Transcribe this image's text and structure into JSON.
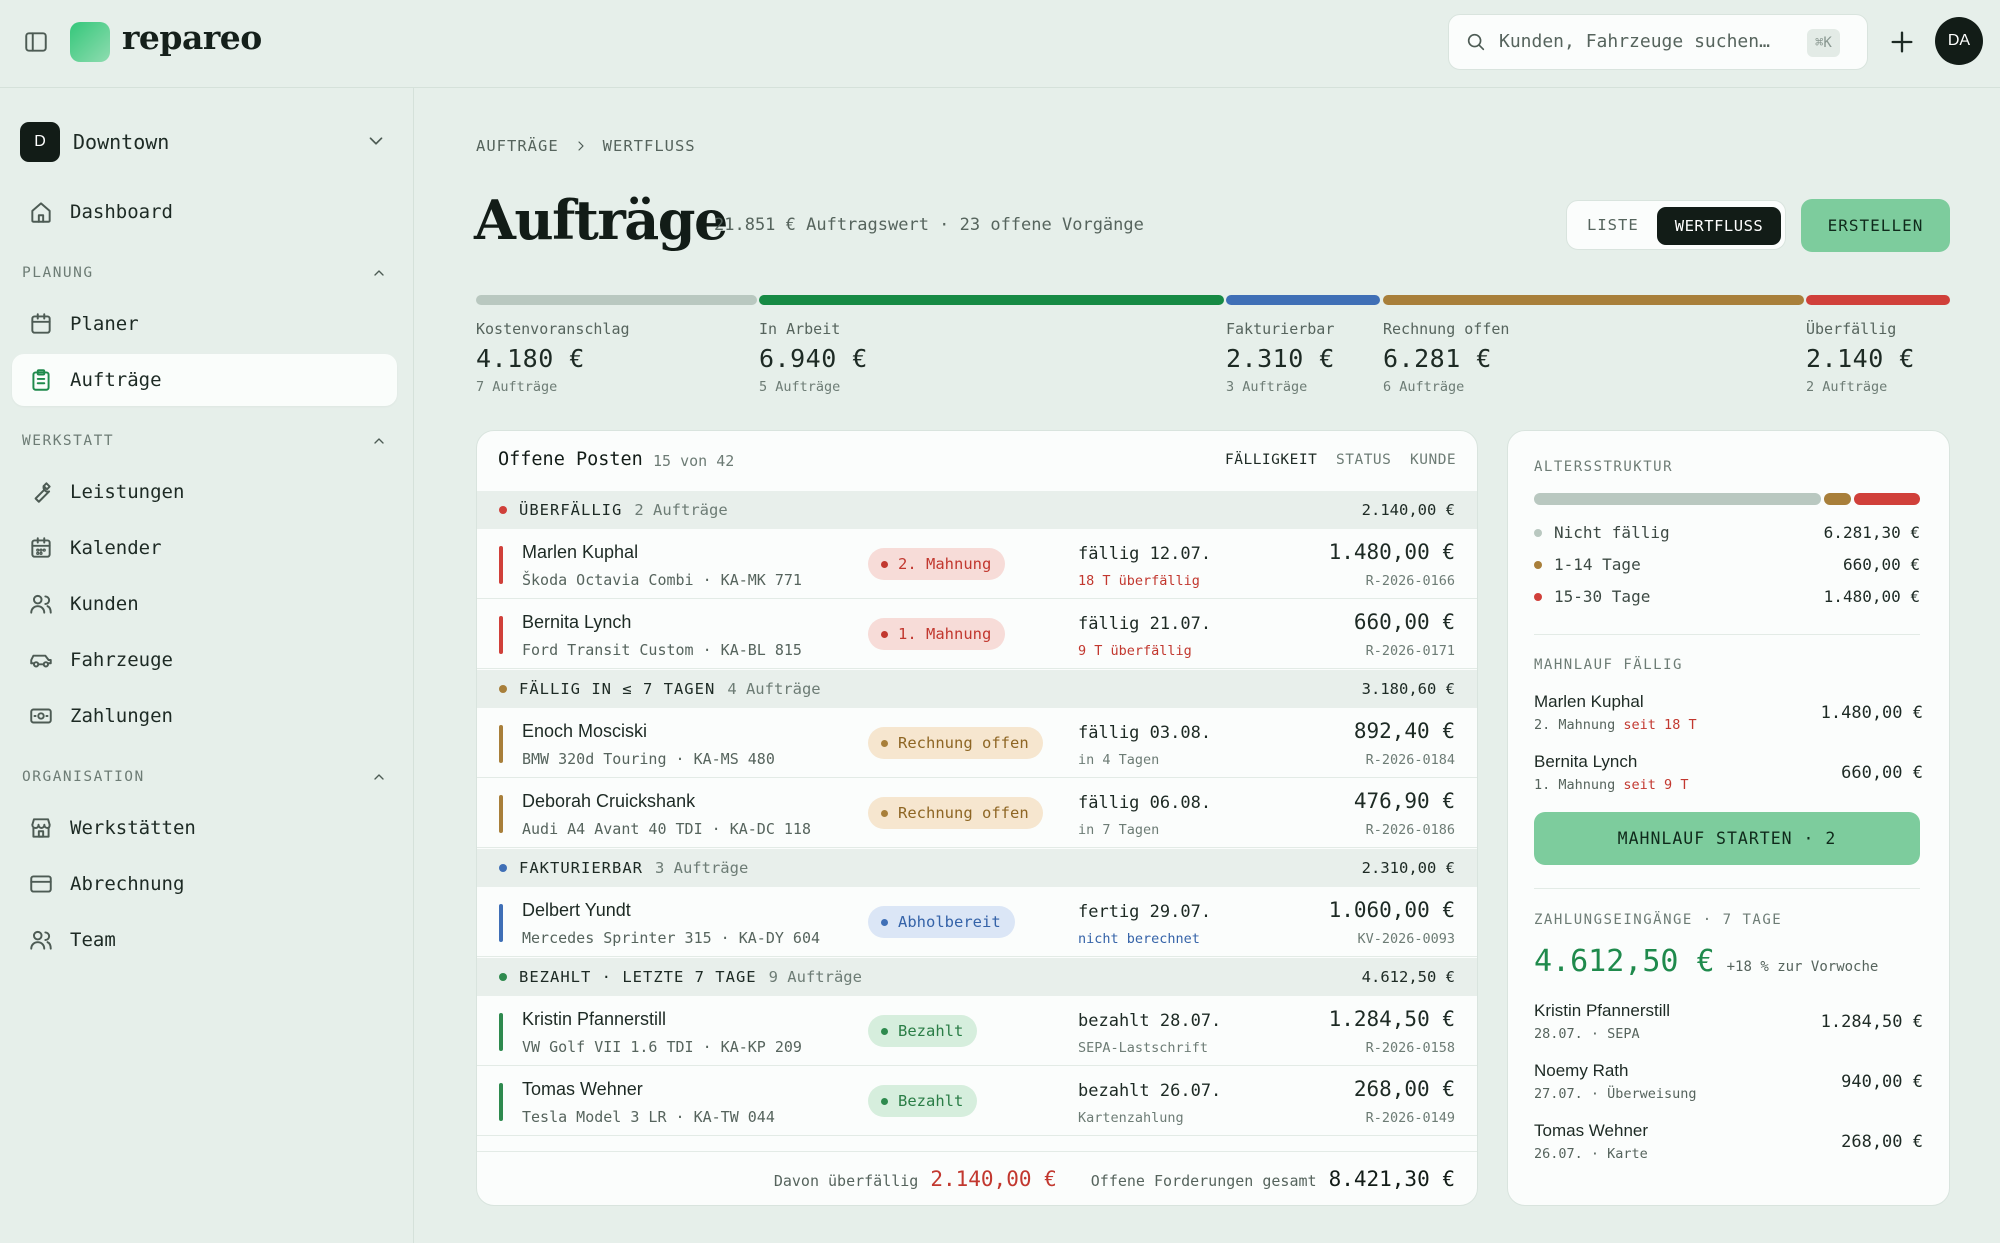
{
  "app": {
    "brand": "repareo",
    "search_placeholder": "Kunden, Fahrzeuge suchen…",
    "search_shortcut": "⌘K",
    "avatar": "DA"
  },
  "sidebar": {
    "location_initial": "D",
    "location_name": "Downtown",
    "dashboard": "Dashboard",
    "sections": [
      {
        "title": "PLANUNG",
        "items": [
          "Planer",
          "Aufträge"
        ]
      },
      {
        "title": "WERKSTATT",
        "items": [
          "Leistungen",
          "Kalender",
          "Kunden",
          "Fahrzeuge",
          "Zahlungen"
        ]
      },
      {
        "title": "ORGANISATION",
        "items": [
          "Werkstätten",
          "Abrechnung",
          "Team"
        ]
      }
    ]
  },
  "breadcrumb": {
    "root": "AUFTRÄGE",
    "current": "WERTFLUSS"
  },
  "header": {
    "title": "Aufträge",
    "subtitle": "21.851 € Auftragswert · 23 offene Vorgänge",
    "view_list": "LISTE",
    "view_flow": "WERTFLUSS",
    "create": "ERSTELLEN"
  },
  "pipeline": [
    {
      "label": "Kostenvoranschlag",
      "amount": "4.180 €",
      "count": "7 Aufträge",
      "color": "#b9c8c0"
    },
    {
      "label": "In Arbeit",
      "amount": "6.940 €",
      "count": "5 Aufträge",
      "color": "#168a44"
    },
    {
      "label": "Fakturierbar",
      "amount": "2.310 €",
      "count": "3 Aufträge",
      "color": "#3f6fb6"
    },
    {
      "label": "Rechnung offen",
      "amount": "6.281 €",
      "count": "6 Aufträge",
      "color": "#a87f3a"
    },
    {
      "label": "Überfällig",
      "amount": "2.140 €",
      "count": "2 Aufträge",
      "color": "#d0403a"
    }
  ],
  "open_items": {
    "title": "Offene Posten",
    "count": "15 von 42",
    "sort": [
      "FÄLLIGKEIT",
      "STATUS",
      "KUNDE"
    ],
    "groups": [
      {
        "label": "ÜBERFÄLLIG",
        "count": "2 Aufträge",
        "sum": "2.140,00 €",
        "color": "#d0403a",
        "rows": [
          {
            "name": "Marlen Kuphal",
            "vehicle": "Škoda Octavia Combi · KA-MK 771",
            "status": "2. Mahnung",
            "due": "fällig 12.07.",
            "due_sub": "18 T überfällig",
            "amount": "1.480,00 €",
            "invoice": "R-2026-0166"
          },
          {
            "name": "Bernita Lynch",
            "vehicle": "Ford Transit Custom · KA-BL 815",
            "status": "1. Mahnung",
            "due": "fällig 21.07.",
            "due_sub": "9 T überfällig",
            "amount": "660,00 €",
            "invoice": "R-2026-0171"
          }
        ]
      },
      {
        "label": "FÄLLIG IN ≤ 7 TAGEN",
        "count": "4 Aufträge",
        "sum": "3.180,60 €",
        "color": "#a87f3a",
        "rows": [
          {
            "name": "Enoch Mosciski",
            "vehicle": "BMW 320d Touring · KA-MS 480",
            "status": "Rechnung offen",
            "due": "fällig 03.08.",
            "due_sub": "in 4 Tagen",
            "amount": "892,40 €",
            "invoice": "R-2026-0184"
          },
          {
            "name": "Deborah Cruickshank",
            "vehicle": "Audi A4 Avant 40 TDI · KA-DC 118",
            "status": "Rechnung offen",
            "due": "fällig 06.08.",
            "due_sub": "in 7 Tagen",
            "amount": "476,90 €",
            "invoice": "R-2026-0186"
          }
        ]
      },
      {
        "label": "FAKTURIERBAR",
        "count": "3 Aufträge",
        "sum": "2.310,00 €",
        "color": "#3f6fb6",
        "rows": [
          {
            "name": "Delbert Yundt",
            "vehicle": "Mercedes Sprinter 315 · KA-DY 604",
            "status": "Abholbereit",
            "due": "fertig 29.07.",
            "due_sub": "nicht berechnet",
            "amount": "1.060,00 €",
            "invoice": "KV-2026-0093"
          }
        ]
      },
      {
        "label": "BEZAHLT · LETZTE 7 TAGE",
        "count": "9 Aufträge",
        "sum": "4.612,50 €",
        "color": "#2e8a4e",
        "rows": [
          {
            "name": "Kristin Pfannerstill",
            "vehicle": "VW Golf VII 1.6 TDI · KA-KP 209",
            "status": "Bezahlt",
            "due": "bezahlt 28.07.",
            "due_sub": "SEPA-Lastschrift",
            "amount": "1.284,50 €",
            "invoice": "R-2026-0158"
          },
          {
            "name": "Tomas Wehner",
            "vehicle": "Tesla Model 3 LR · KA-TW 044",
            "status": "Bezahlt",
            "due": "bezahlt 26.07.",
            "due_sub": "Kartenzahlung",
            "amount": "268,00 €",
            "invoice": "R-2026-0149"
          }
        ]
      }
    ],
    "footer": {
      "overdue_label": "Davon überfällig",
      "overdue_value": "2.140,00 €",
      "total_label": "Offene Forderungen gesamt",
      "total_value": "8.421,30 €"
    }
  },
  "aging": {
    "title": "ALTERSSTRUKTUR",
    "shares": [
      0.75,
      0.08,
      0.17
    ],
    "rows": [
      {
        "label": "Nicht fällig",
        "value": "6.281,30 €",
        "color": "#b9c8c0"
      },
      {
        "label": "1-14 Tage",
        "value": "660,00 €",
        "color": "#a87f3a"
      },
      {
        "label": "15-30 Tage",
        "value": "1.480,00 €",
        "color": "#d0403a"
      }
    ]
  },
  "dunning": {
    "title": "MAHNLAUF FÄLLIG",
    "items": [
      {
        "name": "Marlen Kuphal",
        "level": "2. Mahnung",
        "since": "seit 18 T",
        "amount": "1.480,00 €"
      },
      {
        "name": "Bernita Lynch",
        "level": "1. Mahnung",
        "since": "seit 9 T",
        "amount": "660,00 €"
      }
    ],
    "button": "MAHNLAUF STARTEN · 2"
  },
  "payments": {
    "title": "ZAHLUNGSEINGÄNGE · 7 TAGE",
    "total": "4.612,50 €",
    "delta": "+18 % zur Vorwoche",
    "items": [
      {
        "name": "Kristin Pfannerstill",
        "meta": "28.07. · SEPA",
        "amount": "1.284,50 €"
      },
      {
        "name": "Noemy Rath",
        "meta": "27.07. · Überweisung",
        "amount": "940,00 €"
      },
      {
        "name": "Tomas Wehner",
        "meta": "26.07. · Karte",
        "amount": "268,00 €"
      }
    ]
  }
}
